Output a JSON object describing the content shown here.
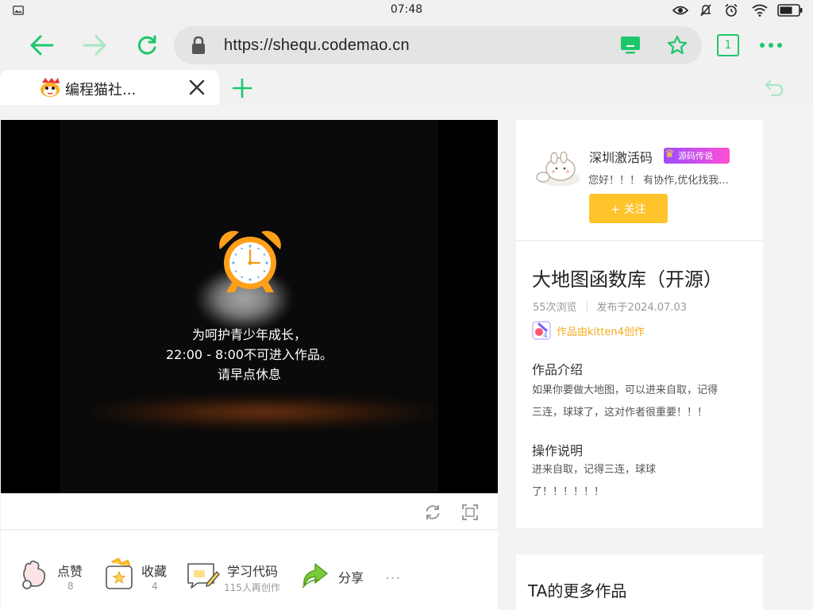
{
  "status": {
    "time": "07:48"
  },
  "browser": {
    "url": "https://shequ.codemao.cn",
    "tab_count": "1",
    "tab_title": "编程猫社..."
  },
  "player": {
    "message": [
      "为呵护青少年成长，",
      "22:00 - 8:00不可进入作品。",
      "请早点休息"
    ]
  },
  "actions": {
    "like": {
      "label": "点赞",
      "count": "8"
    },
    "collect": {
      "label": "收藏",
      "count": "4"
    },
    "learn": {
      "label": "学习代码",
      "count": "115人再创作"
    },
    "share": {
      "label": "分享"
    },
    "more": "···"
  },
  "author": {
    "name": "深圳激活码",
    "badge": "源码传说",
    "signature": "您好！！！ 有协作,优化找我...",
    "follow_label": "+ 关注"
  },
  "work": {
    "title": "大地图函数库（开源）",
    "views": "55次浏览",
    "published": "发布于2024.07.03",
    "made_by": "作品由kitten4创作",
    "intro_heading": "作品介绍",
    "intro_lines": [
      "如果你要做大地图，可以进来自取，记得",
      "三连，球球了，这对作者很重要！！！"
    ],
    "ops_heading": "操作说明",
    "ops_lines": [
      "进来自取，记得三连，球球",
      "了！！！！！！"
    ]
  },
  "more_works": {
    "title": "TA的更多作品"
  },
  "colors": {
    "accent": "#1ec76b",
    "follow": "#ffc42b",
    "made_by": "#f7a91e",
    "clock": "#ff9f1a"
  }
}
